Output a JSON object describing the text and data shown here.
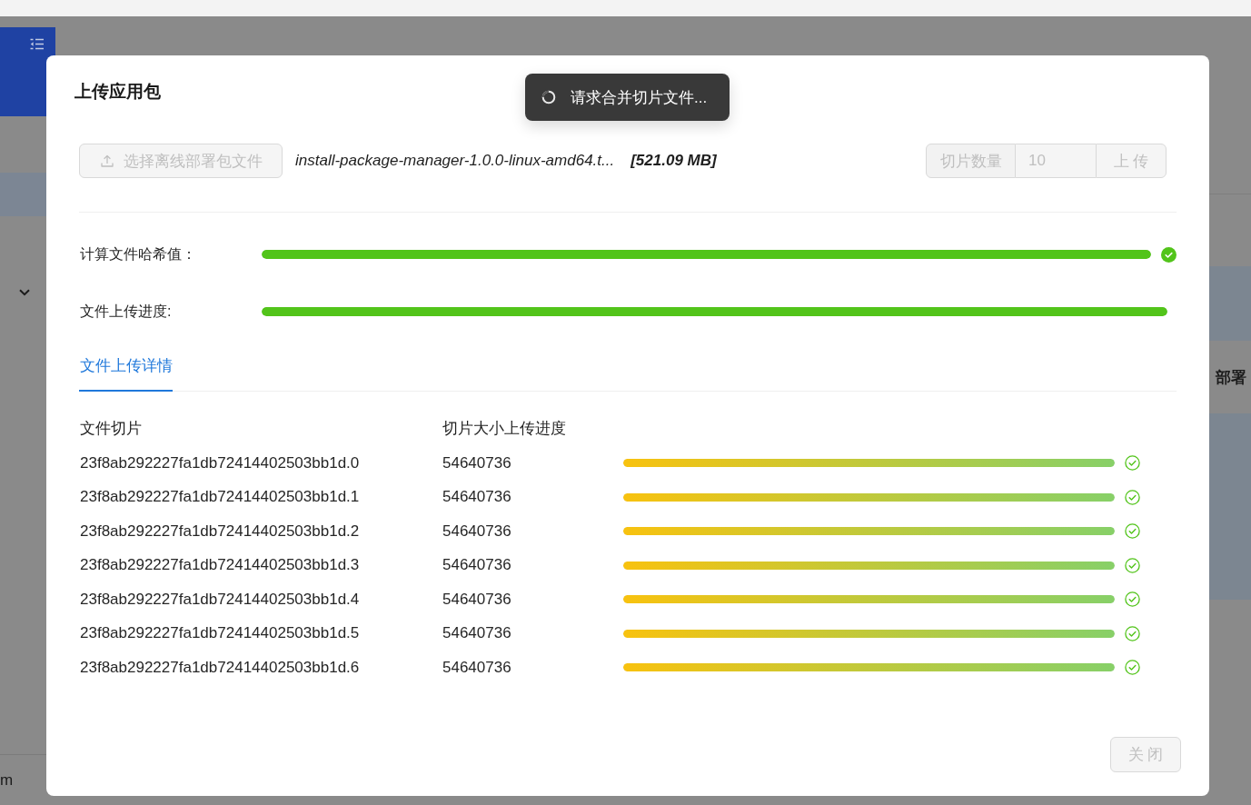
{
  "background": {
    "row_text": "部署",
    "footer_text": "m"
  },
  "dialog": {
    "title": "上传应用包",
    "toast": {
      "text": "请求合并切片文件..."
    },
    "file_button": {
      "label": "选择离线部署包文件",
      "disabled": true
    },
    "file_name": "install-package-manager-1.0.0-linux-amd64.t...",
    "file_size": "[521.09 MB]",
    "slice_count": {
      "label": "切片数量",
      "value": "10",
      "disabled": true
    },
    "upload_button": {
      "label": "上 传",
      "disabled": true
    },
    "progress": [
      {
        "label": "计算文件哈希值：",
        "level": 1,
        "success_icon": true
      },
      {
        "label": "文件上传进度:",
        "level": 1,
        "success_icon": false
      }
    ],
    "tabs": [
      {
        "label": "文件上传详情",
        "selected": true
      }
    ],
    "table": {
      "columns": [
        "文件切片",
        "切片大小上传进度"
      ],
      "rows": [
        {
          "name": "23f8ab292227fa1db72414402503bb1d.0",
          "size": "54640736",
          "level": 1,
          "success_icon": true
        },
        {
          "name": "23f8ab292227fa1db72414402503bb1d.1",
          "size": "54640736",
          "level": 1,
          "success_icon": true
        },
        {
          "name": "23f8ab292227fa1db72414402503bb1d.2",
          "size": "54640736",
          "level": 1,
          "success_icon": true
        },
        {
          "name": "23f8ab292227fa1db72414402503bb1d.3",
          "size": "54640736",
          "level": 1,
          "success_icon": true
        },
        {
          "name": "23f8ab292227fa1db72414402503bb1d.4",
          "size": "54640736",
          "level": 1,
          "success_icon": true
        },
        {
          "name": "23f8ab292227fa1db72414402503bb1d.5",
          "size": "54640736",
          "level": 1,
          "success_icon": true
        },
        {
          "name": "23f8ab292227fa1db72414402503bb1d.6",
          "size": "54640736",
          "level": 1,
          "success_icon": true
        }
      ]
    },
    "close_button": {
      "label": "关 闭",
      "disabled": true
    }
  }
}
